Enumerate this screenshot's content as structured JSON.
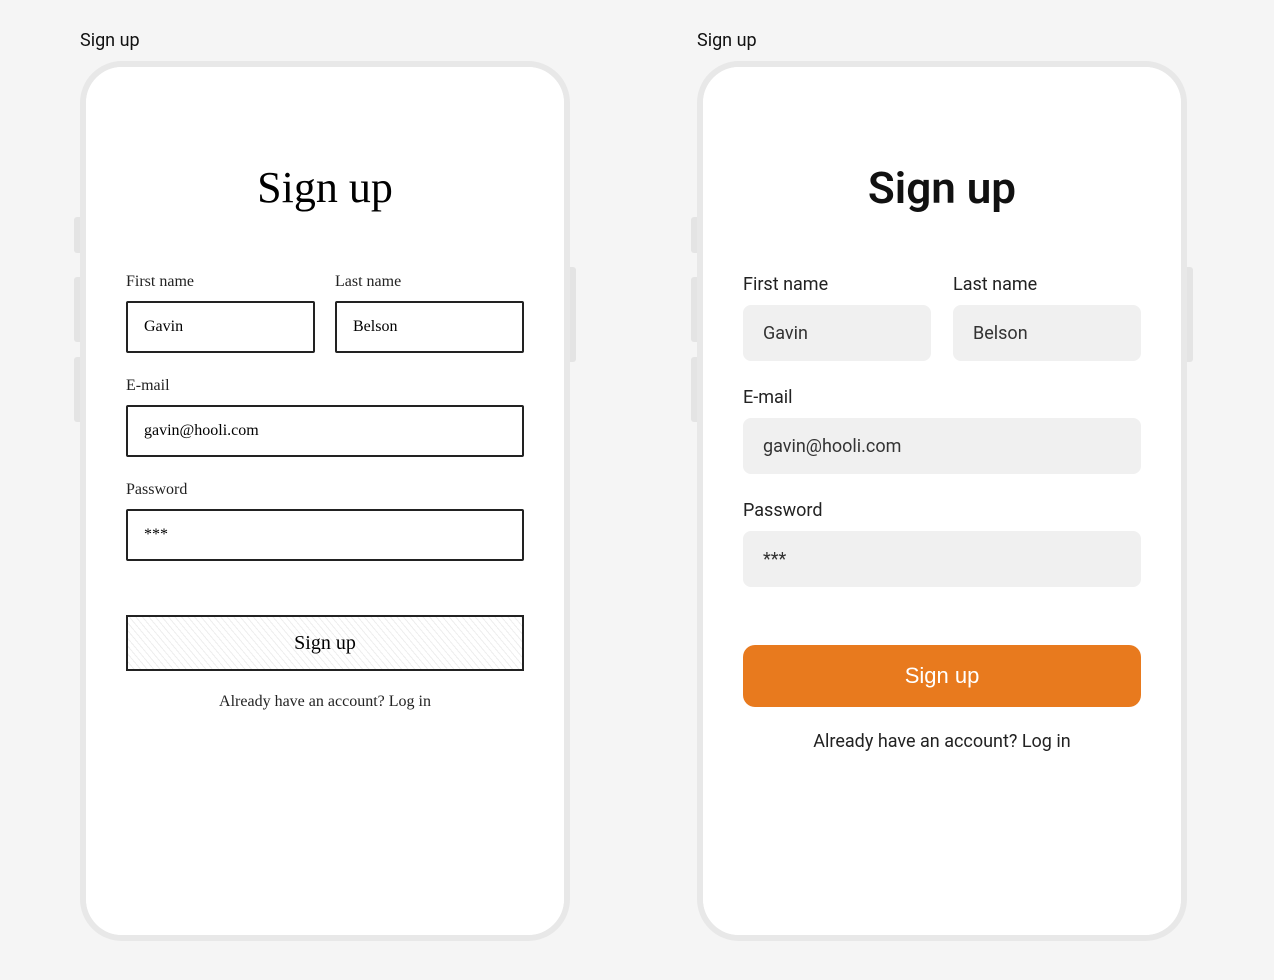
{
  "left": {
    "caption": "Sign up",
    "page_title": "Sign up",
    "first_name": {
      "label": "First name",
      "value": "Gavin"
    },
    "last_name": {
      "label": "Last name",
      "value": "Belson"
    },
    "email": {
      "label": "E-mail",
      "value": "gavin@hooli.com"
    },
    "password": {
      "label": "Password",
      "value": "***"
    },
    "submit_label": "Sign up",
    "footer_text": "Already have an account? Log in"
  },
  "right": {
    "caption": "Sign up",
    "page_title": "Sign up",
    "first_name": {
      "label": "First name",
      "value": "Gavin"
    },
    "last_name": {
      "label": "Last name",
      "value": "Belson"
    },
    "email": {
      "label": "E-mail",
      "value": "gavin@hooli.com"
    },
    "password": {
      "label": "Password",
      "value": "***"
    },
    "submit_label": "Sign up",
    "footer_text": "Already have an account? Log in",
    "accent_color": "#e87a1e"
  }
}
